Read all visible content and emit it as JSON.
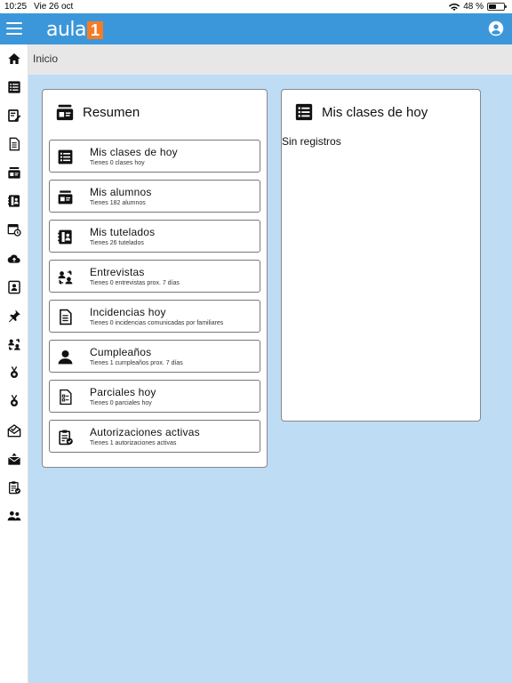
{
  "status": {
    "time": "10:25",
    "date": "Vie 26 oct",
    "battery": "48 %",
    "battery_level": 0.48
  },
  "app": {
    "logo_text": "aula",
    "logo_mark": "1"
  },
  "breadcrumb": "Inicio",
  "sidebar": [
    {
      "icon": "home-icon"
    },
    {
      "icon": "list-icon"
    },
    {
      "icon": "edit-note-icon"
    },
    {
      "icon": "document-icon"
    },
    {
      "icon": "students-icon"
    },
    {
      "icon": "contact-book-icon"
    },
    {
      "icon": "calendar-clock-icon"
    },
    {
      "icon": "cloud-upload-icon"
    },
    {
      "icon": "id-card-icon"
    },
    {
      "icon": "pin-icon"
    },
    {
      "icon": "exchange-users-icon"
    },
    {
      "icon": "medal-icon"
    },
    {
      "icon": "medal-icon"
    },
    {
      "icon": "mail-open-icon"
    },
    {
      "icon": "mail-icon"
    },
    {
      "icon": "clipboard-check-icon"
    },
    {
      "icon": "group-icon"
    }
  ],
  "summary": {
    "title": "Resumen",
    "tiles": [
      {
        "icon": "list-icon",
        "title": "Mis clases de hoy",
        "subtitle": "Tienes 0 clases hoy"
      },
      {
        "icon": "students-icon",
        "title": "Mis alumnos",
        "subtitle": "Tienes 182 alumnos"
      },
      {
        "icon": "contact-book-icon",
        "title": "Mis tutelados",
        "subtitle": "Tienes 26 tutelados"
      },
      {
        "icon": "exchange-users-icon",
        "title": "Entrevistas",
        "subtitle": "Tienes 0 entrevistas prox. 7 días"
      },
      {
        "icon": "document-icon",
        "title": "Incidencias hoy",
        "subtitle": "Tienes 0 incidencias comunicadas por familiares"
      },
      {
        "icon": "person-icon",
        "title": "Cumpleaños",
        "subtitle": "Tienes 1 cumpleaños prox. 7 días"
      },
      {
        "icon": "exam-icon",
        "title": "Parciales hoy",
        "subtitle": "Tienes 0 parciales hoy"
      },
      {
        "icon": "clipboard-check-icon",
        "title": "Autorizaciones activas",
        "subtitle": "Tienes 1 autorizaciones activas"
      }
    ]
  },
  "today": {
    "title": "Mis clases de hoy",
    "empty_text": "Sin registros"
  }
}
